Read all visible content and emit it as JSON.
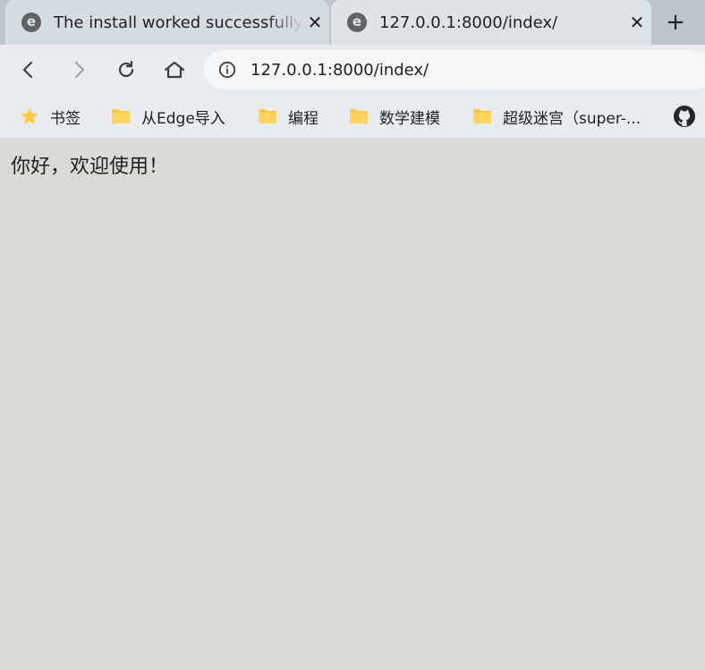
{
  "tabs": [
    {
      "title": "The install worked successfully! Congratulations!",
      "favicon": "edge-e-icon",
      "active": false
    },
    {
      "title": "127.0.0.1:8000/index/",
      "favicon": "edge-e-icon",
      "active": true
    }
  ],
  "tab_close_glyph": "✕",
  "newtab_glyph": "+",
  "address_bar": {
    "url": "127.0.0.1:8000/index/"
  },
  "bookmarks": [
    {
      "label": "书签",
      "icon": "star-icon"
    },
    {
      "label": "从Edge导入",
      "icon": "folder-icon"
    },
    {
      "label": "编程",
      "icon": "folder-icon"
    },
    {
      "label": "数学建模",
      "icon": "folder-icon"
    },
    {
      "label": "超级迷宫（super-...",
      "icon": "folder-icon"
    },
    {
      "label": "",
      "icon": "github-icon"
    }
  ],
  "page": {
    "text": "你好，欢迎使用！"
  },
  "colors": {
    "folder": "#ffc83d",
    "star": "#ffc83d",
    "icon": "#5f6368",
    "page_bg": "#dbdad6"
  }
}
